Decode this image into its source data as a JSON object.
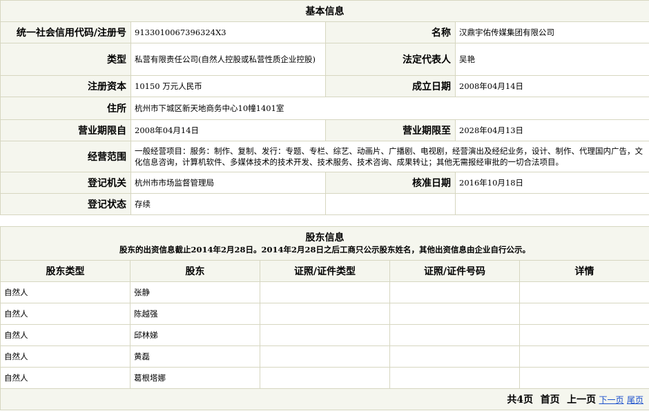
{
  "basic": {
    "title": "基本信息",
    "credit_code_label": "统一社会信用代码/注册号",
    "credit_code": "913301006739632​4X3",
    "name_label": "名称",
    "name": "汉鼎宇佑传媒集团有限公司",
    "type_label": "类型",
    "type": "私营有限责任公司(自然人控股或私营性质企业控股)",
    "legal_rep_label": "法定代表人",
    "legal_rep": "吴艳",
    "capital_label": "注册资本",
    "capital": "10150 万元人民币",
    "established_label": "成立日期",
    "established": "2008年04月14日",
    "address_label": "住所",
    "address": "杭州市下城区新天地商务中心10幢1401室",
    "term_from_label": "营业期限自",
    "term_from": "2008年04月14日",
    "term_to_label": "营业期限至",
    "term_to": "2028年04月13日",
    "scope_label": "经营范围",
    "scope": "一般经营项目：服务：制作、复制、发行：专题、专栏、综艺、动画片、广播剧、电视剧，经营演出及经纪业务，设计、制作、代理国内广告，文化信息咨询，计算机软件、多媒体技术的技术开发、技术服务、技术咨询、成果转让；其他无需报经审批的一切合法项目。",
    "authority_label": "登记机关",
    "authority": "杭州市市场监督管理局",
    "approval_label": "核准日期",
    "approval": "2016年10月18日",
    "status_label": "登记状态",
    "status": "存续"
  },
  "shareholders": {
    "title": "股东信息",
    "notice": "股东的出资信息截止2014年2月28日。2014年2月28日之后工商只公示股东姓名，其他出资信息由企业自行公示。",
    "headers": [
      "股东类型",
      "股东",
      "证照/证件类型",
      "证照/证件号码",
      "详情"
    ],
    "rows": [
      {
        "type": "自然人",
        "name": "张静"
      },
      {
        "type": "自然人",
        "name": "陈越强"
      },
      {
        "type": "自然人",
        "name": "邱林娣"
      },
      {
        "type": "自然人",
        "name": "黄磊"
      },
      {
        "type": "自然人",
        "name": "葛根塔娜"
      }
    ],
    "pager": {
      "total": "共4页",
      "first": "首页",
      "prev": "上一页",
      "next": "下一页",
      "last": "尾页"
    }
  }
}
